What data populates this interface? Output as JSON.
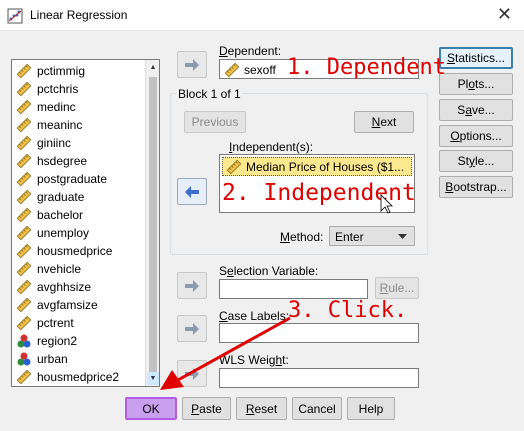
{
  "window": {
    "title": "Linear Regression",
    "close_glyph": "✕"
  },
  "variable_list": {
    "items": [
      {
        "label": "pctimmig",
        "icon": "scale-ruler-icon"
      },
      {
        "label": "pctchris",
        "icon": "scale-ruler-icon"
      },
      {
        "label": "medinc",
        "icon": "scale-ruler-icon"
      },
      {
        "label": "meaninc",
        "icon": "scale-ruler-icon"
      },
      {
        "label": "giniinc",
        "icon": "scale-ruler-icon"
      },
      {
        "label": "hsdegree",
        "icon": "scale-ruler-icon"
      },
      {
        "label": "postgraduate",
        "icon": "scale-ruler-icon"
      },
      {
        "label": "graduate",
        "icon": "scale-ruler-icon"
      },
      {
        "label": "bachelor",
        "icon": "scale-ruler-icon"
      },
      {
        "label": "unemploy",
        "icon": "scale-ruler-icon"
      },
      {
        "label": "housmedprice",
        "icon": "scale-ruler-icon"
      },
      {
        "label": "nvehicle",
        "icon": "scale-ruler-icon"
      },
      {
        "label": "avghhsize",
        "icon": "scale-ruler-icon"
      },
      {
        "label": "avgfamsize",
        "icon": "scale-ruler-icon"
      },
      {
        "label": "pctrent",
        "icon": "scale-ruler-icon"
      },
      {
        "label": "region2",
        "icon": "nominal-balls-icon"
      },
      {
        "label": "urban",
        "icon": "nominal-balls-icon"
      },
      {
        "label": "housmedprice2",
        "icon": "scale-ruler-icon"
      }
    ]
  },
  "dependent": {
    "label_pre": "",
    "label_ul": "D",
    "label_post": "ependent:",
    "value": "sexoff"
  },
  "block": {
    "title": "Block 1 of 1",
    "previous_label": "Previous",
    "next_ul": "N",
    "next_post": "ext"
  },
  "independents": {
    "label_ul": "I",
    "label_post": "ndependent(s):",
    "items": [
      "Median Price of Houses ($1..."
    ]
  },
  "method": {
    "label_ul": "M",
    "label_post": "ethod:",
    "value": "Enter"
  },
  "selection_variable": {
    "label_pre": "S",
    "label_ul": "e",
    "label_post": "lection Variable:",
    "rule_ul": "R",
    "rule_post": "ule..."
  },
  "case_labels": {
    "label_ul": "C",
    "label_post": "ase Labels:"
  },
  "wls_weight": {
    "label_pre": "WLS Weig",
    "label_ul": "h",
    "label_post": "t:"
  },
  "side_buttons": [
    {
      "ul": "S",
      "post": "tatistics..."
    },
    {
      "pre": "Pl",
      "ul": "o",
      "post": "ts..."
    },
    {
      "pre": "S",
      "ul": "a",
      "post": "ve..."
    },
    {
      "ul": "O",
      "post": "ptions..."
    },
    {
      "pre": "St",
      "ul": "y",
      "post": "le..."
    },
    {
      "ul": "B",
      "post": "ootstrap..."
    }
  ],
  "bottom_buttons": {
    "ok": "OK",
    "paste_ul": "P",
    "paste_post": "aste",
    "reset_ul": "R",
    "reset_post": "eset",
    "cancel": "Cancel",
    "help": "Help"
  },
  "annotations": {
    "dependent": "1. Dependent",
    "independent": "2. Independent",
    "click": "3. Click.",
    "color": "#e00000"
  },
  "colors": {
    "ok_button_highlight": "#c9a0ef",
    "arrow_blue": "#3a6fd0",
    "selected_item": "#fce98f"
  }
}
